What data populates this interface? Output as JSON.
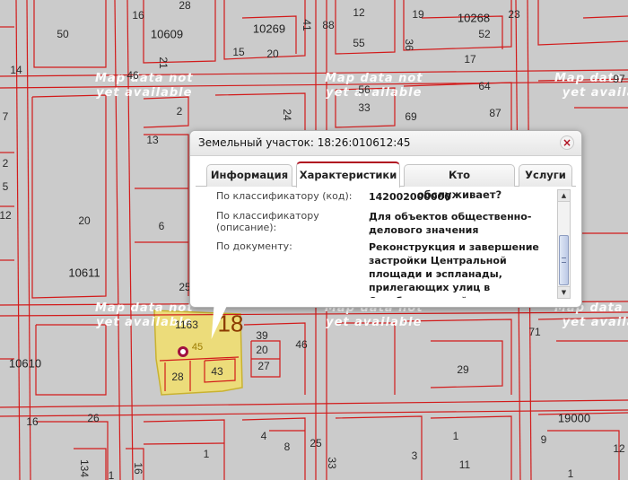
{
  "popup": {
    "title": "Земельный участок: 18:26:010612:45",
    "close_icon": "×",
    "tabs": [
      {
        "label": "Информация",
        "active": false
      },
      {
        "label": "Характеристики",
        "active": true
      },
      {
        "label": "Кто обслуживает?",
        "active": false
      },
      {
        "label": "Услуги",
        "active": false
      }
    ],
    "rows": [
      {
        "key": "По классификатору (код):",
        "value": "142002000000"
      },
      {
        "key": "По классификатору (описание):",
        "value": "Для объектов общественно-делового значения"
      },
      {
        "key": "По документу:",
        "value": "Реконструкция и завершение застройки Центральной площади и эспланады, прилегающих улиц в Октябрьском районе"
      }
    ],
    "scroll_up_icon": "▲",
    "scroll_down_icon": "▼"
  },
  "map": {
    "watermark": {
      "line1": "Map data not",
      "line2": "yet available",
      "line2_short": "yet availab"
    },
    "selected_parcel_label": "45",
    "marker_label": "18",
    "block_labels": [
      "10609",
      "10269",
      "10268",
      "10611",
      "10610",
      "19000"
    ],
    "parcel_labels": [
      "50",
      "16",
      "28",
      "88",
      "12",
      "19",
      "52",
      "23",
      "55",
      "15",
      "20",
      "41",
      "36",
      "17",
      "21",
      "46",
      "97",
      "14",
      "2",
      "33",
      "56",
      "64",
      "87",
      "69",
      "24",
      "13",
      "7",
      "2",
      "5",
      "12",
      "6",
      "20",
      "25",
      "1163",
      "39",
      "20",
      "27",
      "28",
      "43",
      "46",
      "71",
      "29",
      "16",
      "26",
      "4",
      "8",
      "1",
      "25",
      "134",
      "16",
      "33",
      "3",
      "1",
      "11",
      "9",
      "12",
      "1",
      "1"
    ]
  }
}
